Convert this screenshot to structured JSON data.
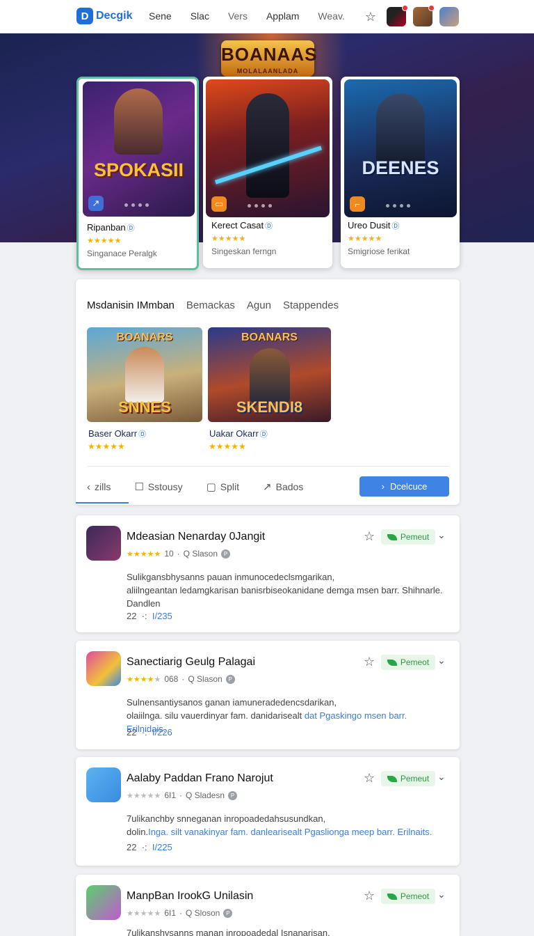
{
  "header": {
    "logo_mark": "D",
    "logo_text": "Decgik",
    "nav": [
      "Sene",
      "Slac",
      "Vers",
      "Applam",
      "Weav."
    ]
  },
  "featured": [
    {
      "art_title": "SPOKASII",
      "name": "Ripanban",
      "stars": "★★★★★",
      "sub": "Singanace Peralgk",
      "icon": "↗"
    },
    {
      "art_title": "",
      "name": "Kerect Casat",
      "stars": "★★★★★",
      "sub": "Singeskan ferngn",
      "icon": "▭"
    },
    {
      "art_title": "DEENES",
      "name": "Ureo Dusit",
      "stars": "★★★★★",
      "sub": "Smigriose ferikat",
      "icon": "⌐"
    }
  ],
  "hero_logo": {
    "title": "BOANAAS",
    "subtitle": "MOLALAANLADA"
  },
  "panel": {
    "tabs": [
      "Msdanisin IMmban",
      "Bemackas",
      "Agun",
      "Stappendes"
    ],
    "tiles": [
      {
        "top": "BOANARS",
        "art": "SNNES",
        "name": "Baser Okarr",
        "stars": "★★★★★"
      },
      {
        "top": "BOANARS",
        "art": "SKENDI8",
        "name": "Uakar Okarr",
        "stars": "★★★★★"
      }
    ],
    "actions": [
      {
        "icon": "‹",
        "label": "zills"
      },
      {
        "icon": "☐",
        "label": "Sstousy"
      },
      {
        "icon": "▢",
        "label": "Split"
      },
      {
        "icon": "↗",
        "label": "Bados"
      }
    ],
    "primary_label": "Dcelcuce",
    "primary_icon": "›"
  },
  "items": [
    {
      "title": "Mdeasian Nenarday 0Jangit",
      "rating": "10",
      "author": "Q Slason",
      "pill": "Pemeut",
      "desc1": "Sulikgansbhysanns pauan inmunocedeclsmgarikan,",
      "desc2": "aliilngeantan ledamgkarisan banisrbiseokanidane demga msen barr. Shihnarle.",
      "desc2_hl": "",
      "desc3": "Dandlen",
      "foot_a": "22",
      "foot_b": "I/235"
    },
    {
      "title": "Sanectiarig Geulg Palagai",
      "rating": "068",
      "author": "Q Slason",
      "pill": "Pemeot",
      "desc1": "Sulnensantiysanos ganan iamuneradedencsdarikan,",
      "desc2": "olaiilnga. silu vauerdinyar fam. danidarisealt ",
      "desc2_hl": "dat Pgaskingo msen barr. Erilnidais.",
      "desc3": "",
      "foot_a": "22",
      "foot_b": "I/226"
    },
    {
      "title": "Aalaby Paddan Frano Narojut",
      "rating": "6I1",
      "author": "Q Sladesn",
      "pill": "Pemeut",
      "desc1": "7ulikanchby snneganan inropoadedahsusundkan,",
      "desc2": "dolin.",
      "desc2_hl": "Inga. silt vanakinyar fam. danlearisealt Pgaslionga meep barr. Erilnaits.",
      "desc3": "",
      "foot_a": "22",
      "foot_b": "I/225"
    },
    {
      "title": "ManpBan IrookG Unilasin",
      "rating": "6I1",
      "author": "Q Sloson",
      "pill": "Pemeot",
      "desc1": "7ulikanshysanns manan inropoadedal Isnanarisan.",
      "desc2": "",
      "desc2_hl": "",
      "desc3": "",
      "foot_a": "",
      "foot_b": ""
    }
  ]
}
